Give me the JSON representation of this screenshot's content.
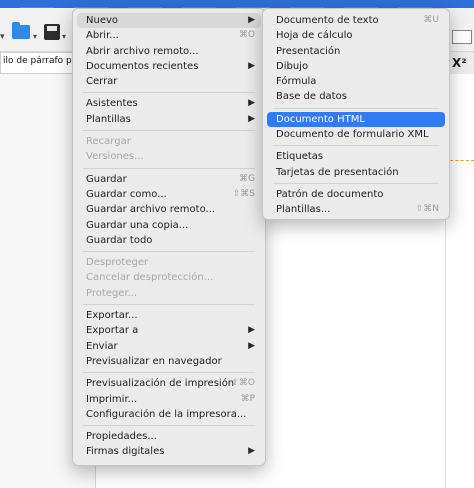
{
  "background": {
    "style_box": "ilo de párrafo pre",
    "superscript_icon": "X²"
  },
  "main_menu": {
    "items": [
      {
        "label": "Nuevo",
        "shortcut": "",
        "submenu": true,
        "disabled": false,
        "highlight": true
      },
      {
        "label": "Abrir...",
        "shortcut": "⌘O",
        "submenu": false,
        "disabled": false
      },
      {
        "label": "Abrir archivo remoto...",
        "shortcut": "",
        "submenu": false,
        "disabled": false
      },
      {
        "label": "Documentos recientes",
        "shortcut": "",
        "submenu": true,
        "disabled": false
      },
      {
        "label": "Cerrar",
        "shortcut": "",
        "submenu": false,
        "disabled": false
      },
      {
        "label": "Asistentes",
        "shortcut": "",
        "submenu": true,
        "disabled": false
      },
      {
        "label": "Plantillas",
        "shortcut": "",
        "submenu": true,
        "disabled": false
      },
      {
        "label": "Recargar",
        "shortcut": "",
        "submenu": false,
        "disabled": true
      },
      {
        "label": "Versiones...",
        "shortcut": "",
        "submenu": false,
        "disabled": true
      },
      {
        "label": "Guardar",
        "shortcut": "⌘G",
        "submenu": false,
        "disabled": false
      },
      {
        "label": "Guardar como...",
        "shortcut": "⇧⌘S",
        "submenu": false,
        "disabled": false
      },
      {
        "label": "Guardar archivo remoto...",
        "shortcut": "",
        "submenu": false,
        "disabled": false
      },
      {
        "label": "Guardar una copia...",
        "shortcut": "",
        "submenu": false,
        "disabled": false
      },
      {
        "label": "Guardar todo",
        "shortcut": "",
        "submenu": false,
        "disabled": false
      },
      {
        "label": "Desproteger",
        "shortcut": "",
        "submenu": false,
        "disabled": true
      },
      {
        "label": "Cancelar desprotección...",
        "shortcut": "",
        "submenu": false,
        "disabled": true
      },
      {
        "label": "Proteger...",
        "shortcut": "",
        "submenu": false,
        "disabled": true
      },
      {
        "label": "Exportar...",
        "shortcut": "",
        "submenu": false,
        "disabled": false
      },
      {
        "label": "Exportar a",
        "shortcut": "",
        "submenu": true,
        "disabled": false
      },
      {
        "label": "Enviar",
        "shortcut": "",
        "submenu": true,
        "disabled": false
      },
      {
        "label": "Previsualizar en navegador",
        "shortcut": "",
        "submenu": false,
        "disabled": false
      },
      {
        "label": "Previsualización de impresión",
        "shortcut": "⇧⌘O",
        "submenu": false,
        "disabled": false
      },
      {
        "label": "Imprimir...",
        "shortcut": "⌘P",
        "submenu": false,
        "disabled": false
      },
      {
        "label": "Configuración de la impresora...",
        "shortcut": "",
        "submenu": false,
        "disabled": false
      },
      {
        "label": "Propiedades...",
        "shortcut": "",
        "submenu": false,
        "disabled": false
      },
      {
        "label": "Firmas digitales",
        "shortcut": "",
        "submenu": true,
        "disabled": false
      }
    ]
  },
  "submenu_nuevo": {
    "items": [
      {
        "label": "Documento de texto",
        "shortcut": "⌘U",
        "active": false
      },
      {
        "label": "Hoja de cálculo",
        "shortcut": "",
        "active": false
      },
      {
        "label": "Presentación",
        "shortcut": "",
        "active": false
      },
      {
        "label": "Dibujo",
        "shortcut": "",
        "active": false
      },
      {
        "label": "Fórmula",
        "shortcut": "",
        "active": false
      },
      {
        "label": "Base de datos",
        "shortcut": "",
        "active": false
      },
      {
        "label": "Documento HTML",
        "shortcut": "",
        "active": true
      },
      {
        "label": "Documento de formulario XML",
        "shortcut": "",
        "active": false
      },
      {
        "label": "Etiquetas",
        "shortcut": "",
        "active": false
      },
      {
        "label": "Tarjetas de presentación",
        "shortcut": "",
        "active": false
      },
      {
        "label": "Patrón de documento",
        "shortcut": "",
        "active": false
      },
      {
        "label": "Plantillas...",
        "shortcut": "⇧⌘N",
        "active": false
      }
    ]
  }
}
